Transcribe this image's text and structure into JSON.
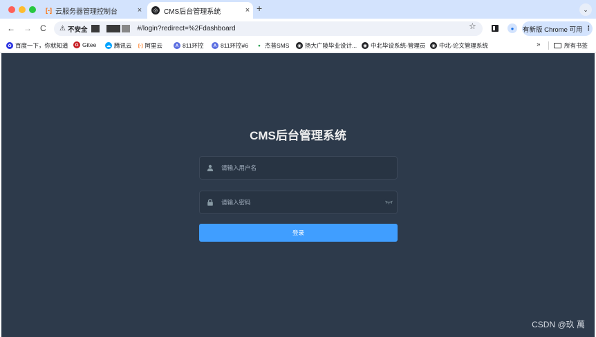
{
  "tabs": [
    {
      "title": "云服务器管理控制台",
      "close": "×"
    },
    {
      "title": "CMS后台管理系统",
      "close": "×"
    }
  ],
  "new_tab": "+",
  "tab_menu": "⌄",
  "address": {
    "back": "←",
    "forward": "→",
    "reload": "C",
    "security_label": "不安全",
    "url_path": "#/login?redirect=%2Fdashboard"
  },
  "update_button": {
    "label": "有新版 Chrome 可用",
    "dots": "⋮"
  },
  "bookmarks": [
    {
      "label": "百度一下，你就知道",
      "color": "#2932e1",
      "glyph": "✿"
    },
    {
      "label": "Gitee",
      "color": "#c71d23",
      "glyph": "G"
    },
    {
      "label": "腾讯云",
      "color": "#00a3ff",
      "glyph": "☁"
    },
    {
      "label": "阿里云",
      "color": "#ff6a00",
      "glyph": "[-]"
    },
    {
      "label": "811环控",
      "color": "#5b6ee1",
      "glyph": "A"
    },
    {
      "label": "811环控#6",
      "color": "#5b6ee1",
      "glyph": "A"
    },
    {
      "label": "杰普SMS",
      "color": "#2aa052",
      "glyph": "●"
    },
    {
      "label": "扬大广陵毕业设计...",
      "color": "#202124",
      "glyph": "◉"
    },
    {
      "label": "中北毕设系统-管理员",
      "color": "#202124",
      "glyph": "◉"
    },
    {
      "label": "中北-论文管理系统",
      "color": "#202124",
      "glyph": "◉"
    }
  ],
  "bookmarks_more": "»",
  "bookmarks_folder": "所有书签",
  "login": {
    "title": "CMS后台管理系统",
    "username_placeholder": "请输入用户名",
    "password_placeholder": "请输入密码",
    "submit_label": "登录"
  },
  "watermark": "CSDN @玖 萬",
  "colors": {
    "page_bg": "#2d3a4b",
    "input_bg": "#283443",
    "button": "#409eff",
    "tabstrip": "#d3e3fd"
  }
}
